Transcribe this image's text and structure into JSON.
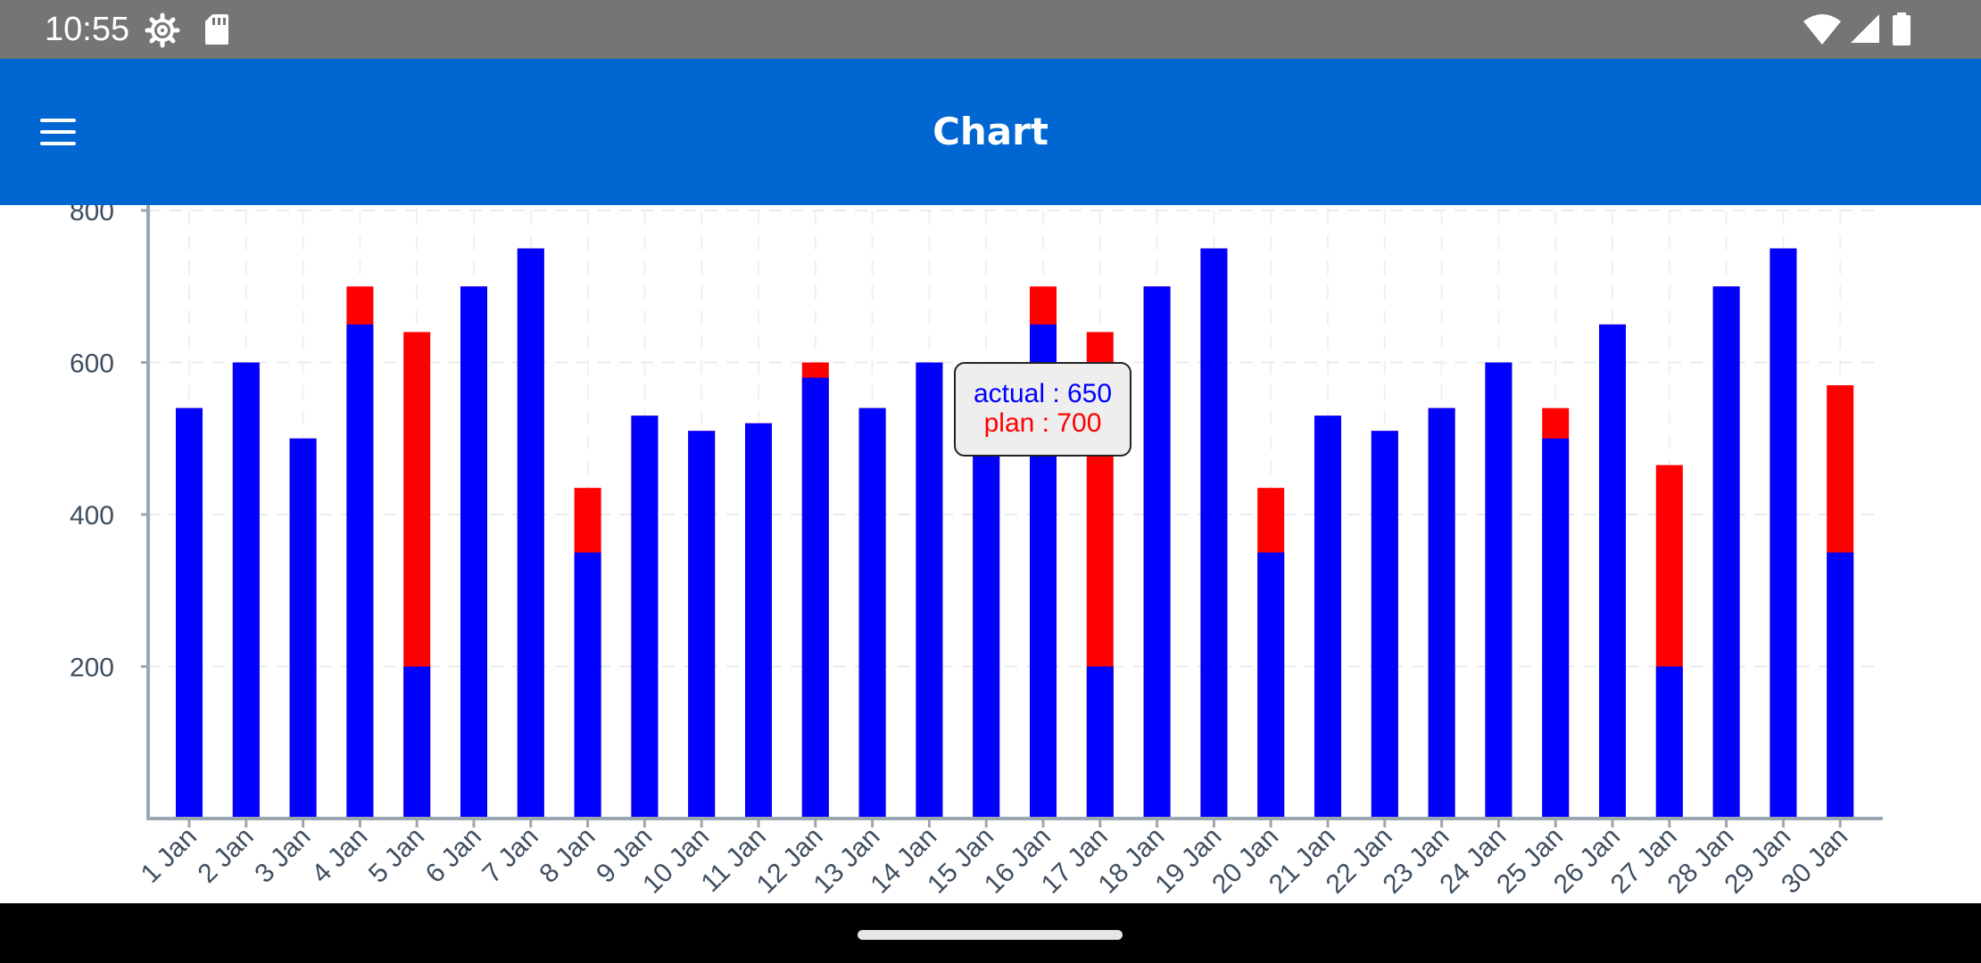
{
  "status_bar": {
    "time": "10:55",
    "icons": [
      "settings-icon",
      "sd-card-icon",
      "wifi-icon",
      "signal-icon",
      "battery-icon"
    ]
  },
  "app_bar": {
    "title": "Chart",
    "menu_icon": "menu-icon",
    "color": "#0066d1"
  },
  "tooltip": {
    "actual": "actual : 650",
    "plan": "plan : 700"
  },
  "chart_data": {
    "type": "bar",
    "stacked": "overlay",
    "categories": [
      "1 Jan",
      "2 Jan",
      "3 Jan",
      "4 Jan",
      "5 Jan",
      "6 Jan",
      "7 Jan",
      "8 Jan",
      "9 Jan",
      "10 Jan",
      "11 Jan",
      "12 Jan",
      "13 Jan",
      "14 Jan",
      "15 Jan",
      "16 Jan",
      "17 Jan",
      "18 Jan",
      "19 Jan",
      "20 Jan",
      "21 Jan",
      "22 Jan",
      "23 Jan",
      "24 Jan",
      "25 Jan",
      "26 Jan",
      "27 Jan",
      "28 Jan",
      "29 Jan",
      "30 Jan"
    ],
    "series": [
      {
        "name": "actual",
        "color": "#0000ff",
        "values": [
          540,
          600,
          500,
          650,
          200,
          700,
          750,
          350,
          530,
          510,
          520,
          580,
          540,
          600,
          500,
          650,
          200,
          700,
          750,
          350,
          530,
          510,
          540,
          600,
          500,
          650,
          200,
          700,
          750,
          350
        ]
      },
      {
        "name": "plan",
        "color": "#ff0000",
        "values": [
          540,
          600,
          500,
          700,
          640,
          700,
          750,
          435,
          530,
          510,
          520,
          600,
          540,
          600,
          500,
          700,
          640,
          700,
          750,
          435,
          530,
          510,
          540,
          600,
          540,
          650,
          465,
          700,
          750,
          570
        ]
      }
    ],
    "y_ticks": [
      200,
      400,
      600,
      800
    ],
    "ylim": [
      0,
      800
    ],
    "grid": true,
    "title": "",
    "xlabel": "",
    "ylabel": ""
  }
}
